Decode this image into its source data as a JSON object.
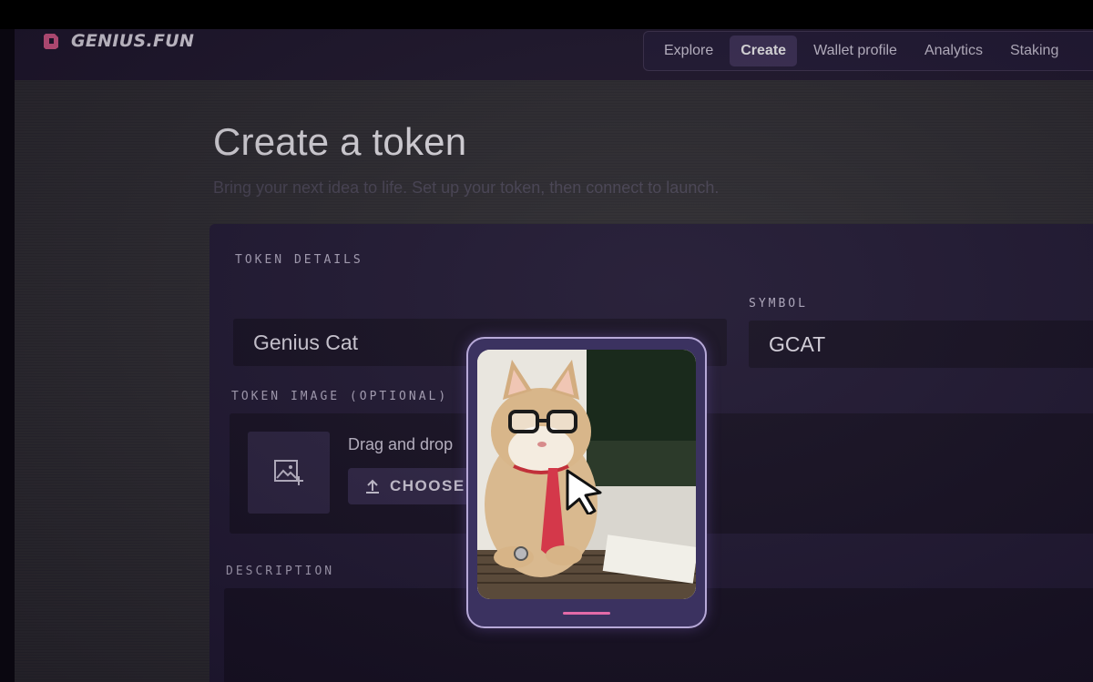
{
  "app": {
    "name": "GENIUS.FUN",
    "accent": "#e85c8f"
  },
  "nav": {
    "items": [
      {
        "label": "Explore",
        "active": false
      },
      {
        "label": "Create",
        "active": true
      },
      {
        "label": "Wallet profile",
        "active": false
      },
      {
        "label": "Analytics",
        "active": false
      },
      {
        "label": "Staking",
        "active": false
      }
    ]
  },
  "page": {
    "title": "Create a token",
    "subtitle": "Bring your next idea to life. Set up your token, then connect to launch."
  },
  "form": {
    "section_label": "TOKEN DETAILS",
    "name_value": "Genius Cat",
    "symbol_label": "SYMBOL",
    "symbol_value": "GCAT",
    "image_label": "TOKEN IMAGE (OPTIONAL)",
    "drop_text": "Drag and drop",
    "choose_label": "CHOOSE",
    "description_label": "DESCRIPTION"
  },
  "preview": {
    "icon": "cat-with-glasses-and-tie-image"
  },
  "icons": {
    "logo": "genius-logo-icon",
    "image_placeholder": "image-add-icon",
    "upload": "upload-icon",
    "cursor": "pointer-cursor-icon"
  }
}
